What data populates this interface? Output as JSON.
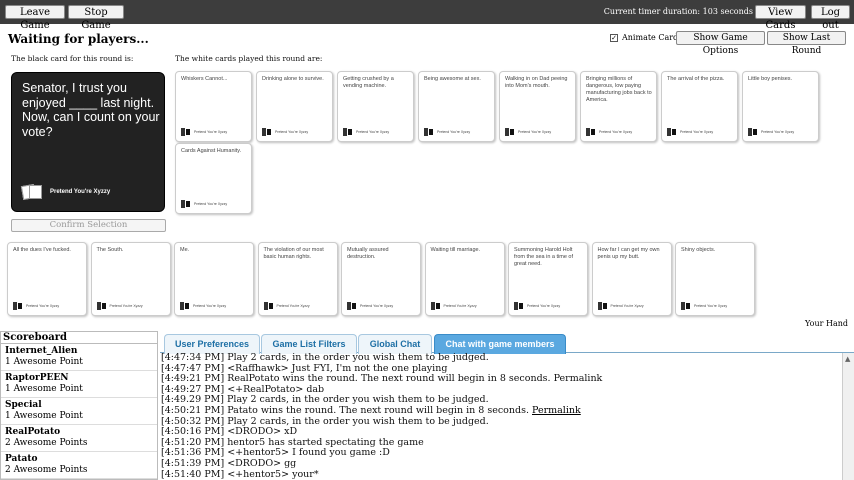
{
  "topbar": {
    "leave_label": "Leave Game",
    "stop_label": "Stop Game",
    "timer_text": "Current timer duration: 103 seconds",
    "view_cards_label": "View Cards",
    "logout_label": "Log out"
  },
  "status": {
    "waiting": "Waiting for players...",
    "animate_label": "Animate Cards",
    "show_options_label": "Show Game Options",
    "show_last_round_label": "Show Last Round"
  },
  "labels": {
    "black_card_label": "The black card for this round is:",
    "white_cards_label": "The white cards played this round are:",
    "your_hand": "Your Hand"
  },
  "black_card": {
    "text": "Senator, I trust you enjoyed ____ last night. Now, can I count on your vote?",
    "brand": "Pretend You're Xyzzy"
  },
  "confirm_label": "Confirm Selection",
  "card_brand": "Pretend You're Xyzzy",
  "played_cards": [
    "Whiskers Cannot...",
    "Drinking alone to survive.",
    "Getting crushed by a vending machine.",
    "Being awesome at sex.",
    "Walking in on Dad peeing into Mom's mouth.",
    "Bringing millions of dangerous, low paying manufacturing jobs back to America.",
    "The arrival of the pizza.",
    "Little boy penises.",
    "Cards Against Humanity."
  ],
  "hand_cards": [
    "All the dues I've fucked.",
    "The South.",
    "Me.",
    "The violation of our most basic human rights.",
    "Mutually assured destruction.",
    "Waiting till marriage.",
    "Summoning Harold Holt from the sea in a time of great need.",
    "How far I can get my own penis up my butt.",
    "Shiny objects."
  ],
  "scoreboard": {
    "title": "Scoreboard",
    "players": [
      {
        "name": "Internet_Alien",
        "points": "1 Awesome Point"
      },
      {
        "name": "RaptorPEEN",
        "points": "1 Awesome Point"
      },
      {
        "name": "Special",
        "points": "1 Awesome Point"
      },
      {
        "name": "RealPotato",
        "points": "2 Awesome Points"
      },
      {
        "name": "Patato",
        "points": "2 Awesome Points"
      }
    ]
  },
  "tabs": [
    "User Preferences",
    "Game List Filters",
    "Global Chat",
    "Chat with game members"
  ],
  "chat": [
    {
      "text": "[4:47:34 PM] Play 2 cards, in the order you wish them to be judged.",
      "link": ""
    },
    {
      "text": "[4:47:47 PM] <Raffhawk> Just FYI, I'm not the one playing",
      "link": ""
    },
    {
      "text": "[4:49:21 PM] RealPotato wins the round. The next round will begin in 8 seconds. Permalink",
      "link": ""
    },
    {
      "text": "[4:49:27 PM] <+RealPotato> dab",
      "link": ""
    },
    {
      "text": "[4:49.29 PM] Play 2 cards, in the order you wish them to be judged.",
      "link": ""
    },
    {
      "text": "[4:50:21 PM] Patato wins the round. The next round will begin in 8 seconds. ",
      "link": "Permalink"
    },
    {
      "text": "[4:50:32 PM] Play 2 cards, in the order you wish them to be judged.",
      "link": ""
    },
    {
      "text": "[4:50:16 PM] <DRODO> xD",
      "link": ""
    },
    {
      "text": "[4:51:20 PM] hentor5 has started spectating the game",
      "link": ""
    },
    {
      "text": "[4:51:36 PM] <+hentor5> I found you game :D",
      "link": ""
    },
    {
      "text": "[4:51:39 PM] <DRODO> gg",
      "link": ""
    },
    {
      "text": "[4:51:40 PM] <+hentor5> your*",
      "link": ""
    }
  ]
}
